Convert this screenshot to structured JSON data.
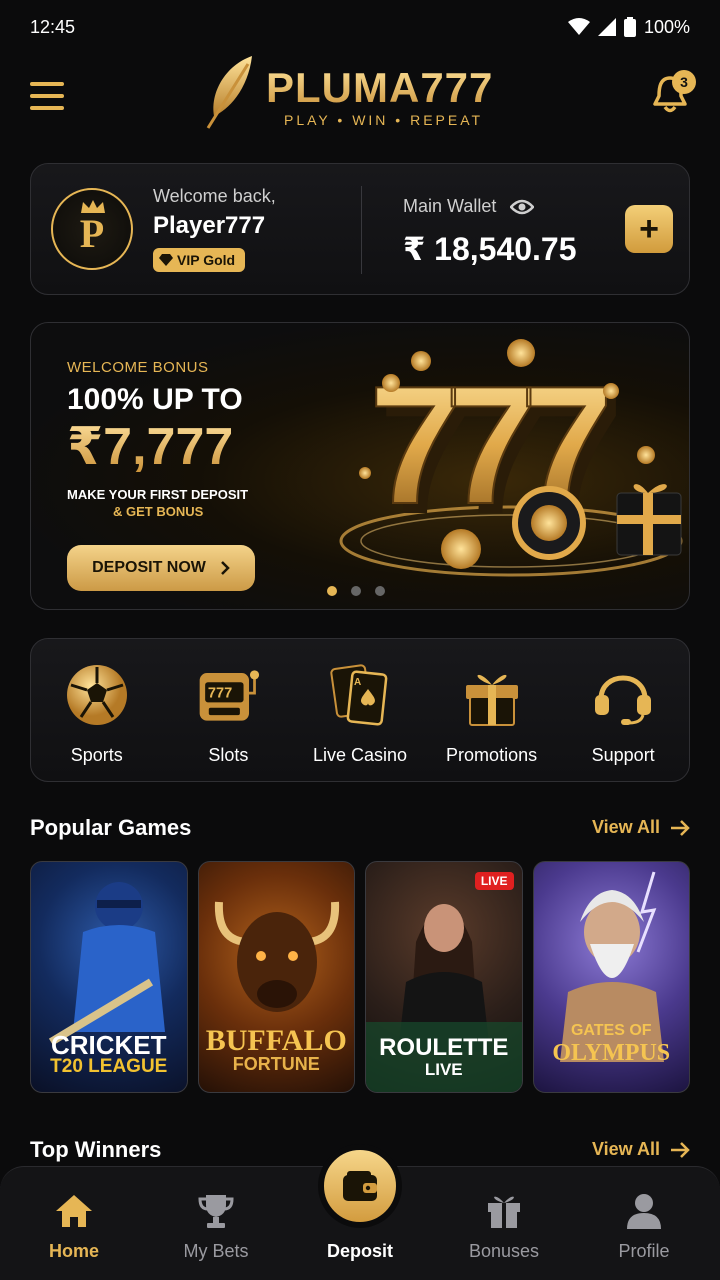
{
  "status": {
    "time": "12:45",
    "battery": "100%"
  },
  "header": {
    "brand": "PLUMA777",
    "tagline": "PLAY • WIN • REPEAT",
    "notification_count": "3"
  },
  "wallet": {
    "welcome": "Welcome back,",
    "player": "Player777",
    "vip": "VIP Gold",
    "label": "Main Wallet",
    "amount": "₹ 18,540.75",
    "add_label": "+"
  },
  "banner": {
    "eyebrow": "WELCOME BONUS",
    "title": "100% UP TO",
    "amount": "₹7,777",
    "sub1": "MAKE YOUR FIRST DEPOSIT",
    "sub2": "& GET BONUS",
    "button": "DEPOSIT NOW",
    "art_text": "777",
    "slides": 3,
    "active_slide": 1
  },
  "categories": [
    {
      "label": "Sports",
      "icon": "soccer-ball-icon"
    },
    {
      "label": "Slots",
      "icon": "slot-machine-icon"
    },
    {
      "label": "Live Casino",
      "icon": "playing-cards-icon"
    },
    {
      "label": "Promotions",
      "icon": "gift-box-icon"
    },
    {
      "label": "Support",
      "icon": "headset-icon"
    }
  ],
  "popular": {
    "title": "Popular Games",
    "view_all": "View All",
    "games": [
      {
        "line1": "CRICKET",
        "line2": "T20 LEAGUE"
      },
      {
        "line1": "BUFFALO",
        "line2": "FORTUNE"
      },
      {
        "line1": "ROULETTE",
        "line2": "LIVE",
        "badge": "LIVE"
      },
      {
        "line1": "GATES OF",
        "line2": "OLYMPUS"
      }
    ]
  },
  "winners": {
    "title": "Top Winners",
    "view_all": "View All"
  },
  "nav": {
    "home": "Home",
    "bets": "My Bets",
    "deposit": "Deposit",
    "bonuses": "Bonuses",
    "profile": "Profile"
  },
  "colors": {
    "accent": "#e6b655",
    "background": "#0b0b0c",
    "live": "#e02020"
  }
}
